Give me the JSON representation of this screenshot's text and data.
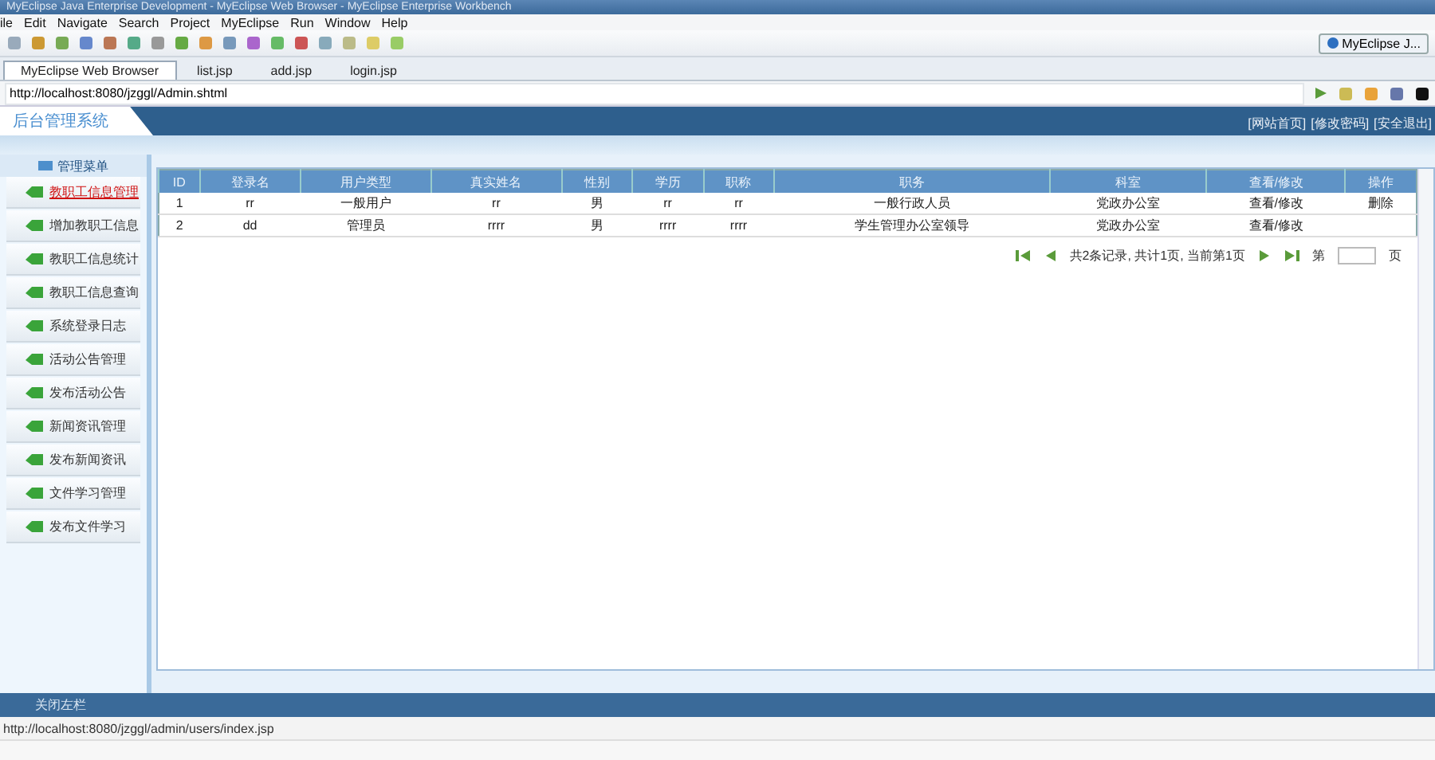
{
  "window": {
    "title": "MyEclipse Java Enterprise Development - MyEclipse Web Browser - MyEclipse Enterprise Workbench"
  },
  "menu": [
    "ile",
    "Edit",
    "Navigate",
    "Search",
    "Project",
    "MyEclipse",
    "Run",
    "Window",
    "Help"
  ],
  "perspective": {
    "label": "MyEclipse J..."
  },
  "editor_tabs": [
    {
      "label": "MyEclipse Web Browser",
      "selected": true
    },
    {
      "label": "list.jsp",
      "selected": false
    },
    {
      "label": "add.jsp",
      "selected": false
    },
    {
      "label": "login.jsp",
      "selected": false
    }
  ],
  "address": {
    "value": "http://localhost:8080/jzggl/Admin.shtml"
  },
  "page": {
    "header_title": "后台管理系统",
    "header_links": [
      "[网站首页]",
      "[修改密码]",
      "[安全退出]"
    ],
    "sidebar": {
      "title": "管理菜单",
      "items": [
        {
          "label": "教职工信息管理",
          "selected": true
        },
        {
          "label": "增加教职工信息",
          "selected": false
        },
        {
          "label": "教职工信息统计",
          "selected": false
        },
        {
          "label": "教职工信息查询",
          "selected": false
        },
        {
          "label": "系统登录日志",
          "selected": false
        },
        {
          "label": "活动公告管理",
          "selected": false
        },
        {
          "label": "发布活动公告",
          "selected": false
        },
        {
          "label": "新闻资讯管理",
          "selected": false
        },
        {
          "label": "发布新闻资讯",
          "selected": false
        },
        {
          "label": "文件学习管理",
          "selected": false
        },
        {
          "label": "发布文件学习",
          "selected": false
        }
      ]
    },
    "table": {
      "columns": [
        "ID",
        "登录名",
        "用户类型",
        "真实姓名",
        "性别",
        "学历",
        "职称",
        "职务",
        "科室",
        "查看/修改",
        "操作"
      ],
      "rows": [
        [
          "1",
          "rr",
          "一般用户",
          "rr",
          "男",
          "rr",
          "rr",
          "一般行政人员",
          "党政办公室",
          "查看/修改",
          "删除"
        ],
        [
          "2",
          "dd",
          "管理员",
          "rrrr",
          "男",
          "rrrr",
          "rrrr",
          "学生管理办公室领导",
          "党政办公室",
          "查看/修改",
          ""
        ]
      ]
    },
    "pagination": {
      "summary": "共2条记录, 共计1页, 当前第1页",
      "page_prefix": "第",
      "page_suffix": "页"
    },
    "footer": {
      "toggle": "关闭左栏"
    }
  },
  "status_bar": {
    "url": "http://localhost:8080/jzggl/admin/users/index.jsp"
  }
}
